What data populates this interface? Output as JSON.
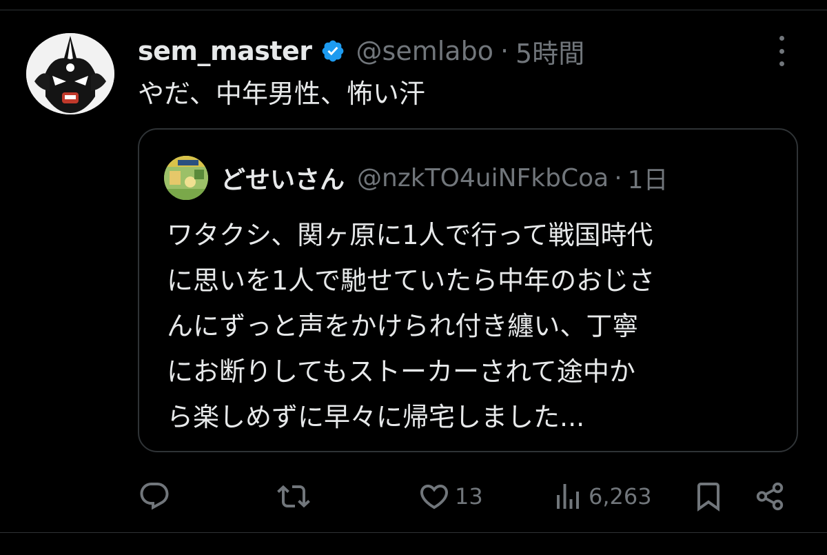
{
  "tweet": {
    "author": {
      "display_name": "sem_master",
      "handle": "@semlabo",
      "verified": true
    },
    "separator": "·",
    "time": "5時間",
    "text": "やだ、中年男性、怖い汗"
  },
  "quoted_tweet": {
    "author": {
      "display_name": "どせいさん",
      "handle": "@nzkTO4uiNFkbCoa"
    },
    "separator": "·",
    "time": "1日",
    "text_lines": [
      "ワタクシ、関ヶ原に1人で行って戦国時代",
      "に思いを1人で馳せていたら中年のおじさ",
      "んにずっと声をかけられ付き纏い、丁寧",
      "にお断りしてもストーカーされて途中か",
      "ら楽しめずに早々に帰宅しました..."
    ]
  },
  "actions": {
    "reply": {
      "icon": "reply-icon"
    },
    "repost": {
      "icon": "repost-icon"
    },
    "like": {
      "icon": "heart-icon",
      "count": "13"
    },
    "views": {
      "icon": "views-icon",
      "count": "6,263"
    },
    "bookmark": {
      "icon": "bookmark-icon"
    },
    "share": {
      "icon": "share-icon"
    }
  },
  "colors": {
    "background": "#000000",
    "primary_text": "#e7e9ea",
    "secondary_text": "#71767b",
    "border": "#2f3336",
    "verified_badge": "#1d9bf0"
  }
}
